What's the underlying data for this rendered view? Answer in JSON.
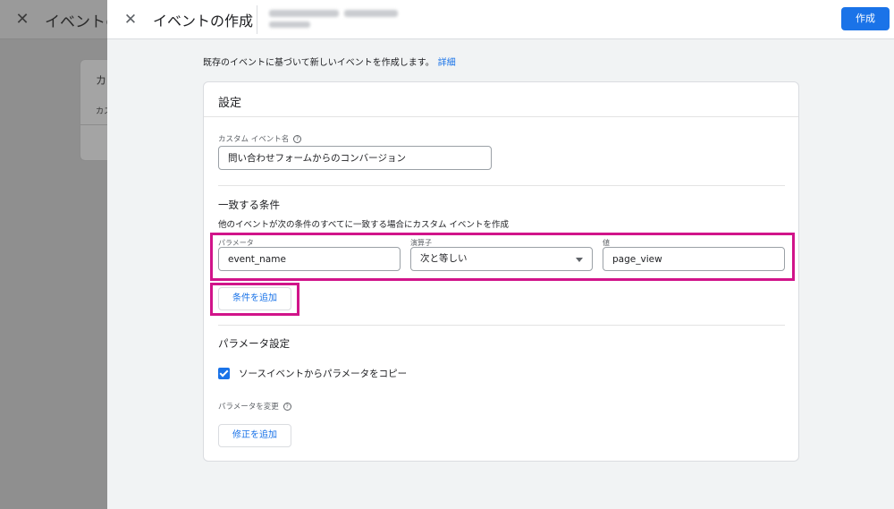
{
  "background": {
    "title": "イベントの",
    "card_title": "カ",
    "card_sub": "カス"
  },
  "header": {
    "title": "イベントの作成",
    "create_label": "作成"
  },
  "intro": {
    "text": "既存のイベントに基づいて新しいイベントを作成します。",
    "link": "詳細"
  },
  "settings": {
    "title": "設定",
    "custom_event_label": "カスタム イベント名",
    "custom_event_value": "問い合わせフォームからのコンバージョン"
  },
  "conditions": {
    "title": "一致する条件",
    "description": "他のイベントが次の条件のすべてに一致する場合にカスタム イベントを作成",
    "param_label": "パラメータ",
    "param_value": "event_name",
    "operator_label": "演算子",
    "operator_value": "次と等しい",
    "value_label": "値",
    "value_value": "page_view",
    "add_condition_label": "条件を追加"
  },
  "param_settings": {
    "title": "パラメータ設定",
    "copy_checkbox_label": "ソースイベントからパラメータをコピー",
    "copy_checked": true,
    "modify_label": "パラメータを変更",
    "add_modification_label": "修正を追加"
  },
  "colors": {
    "accent": "#1a73e8",
    "highlight": "#d1148a"
  }
}
